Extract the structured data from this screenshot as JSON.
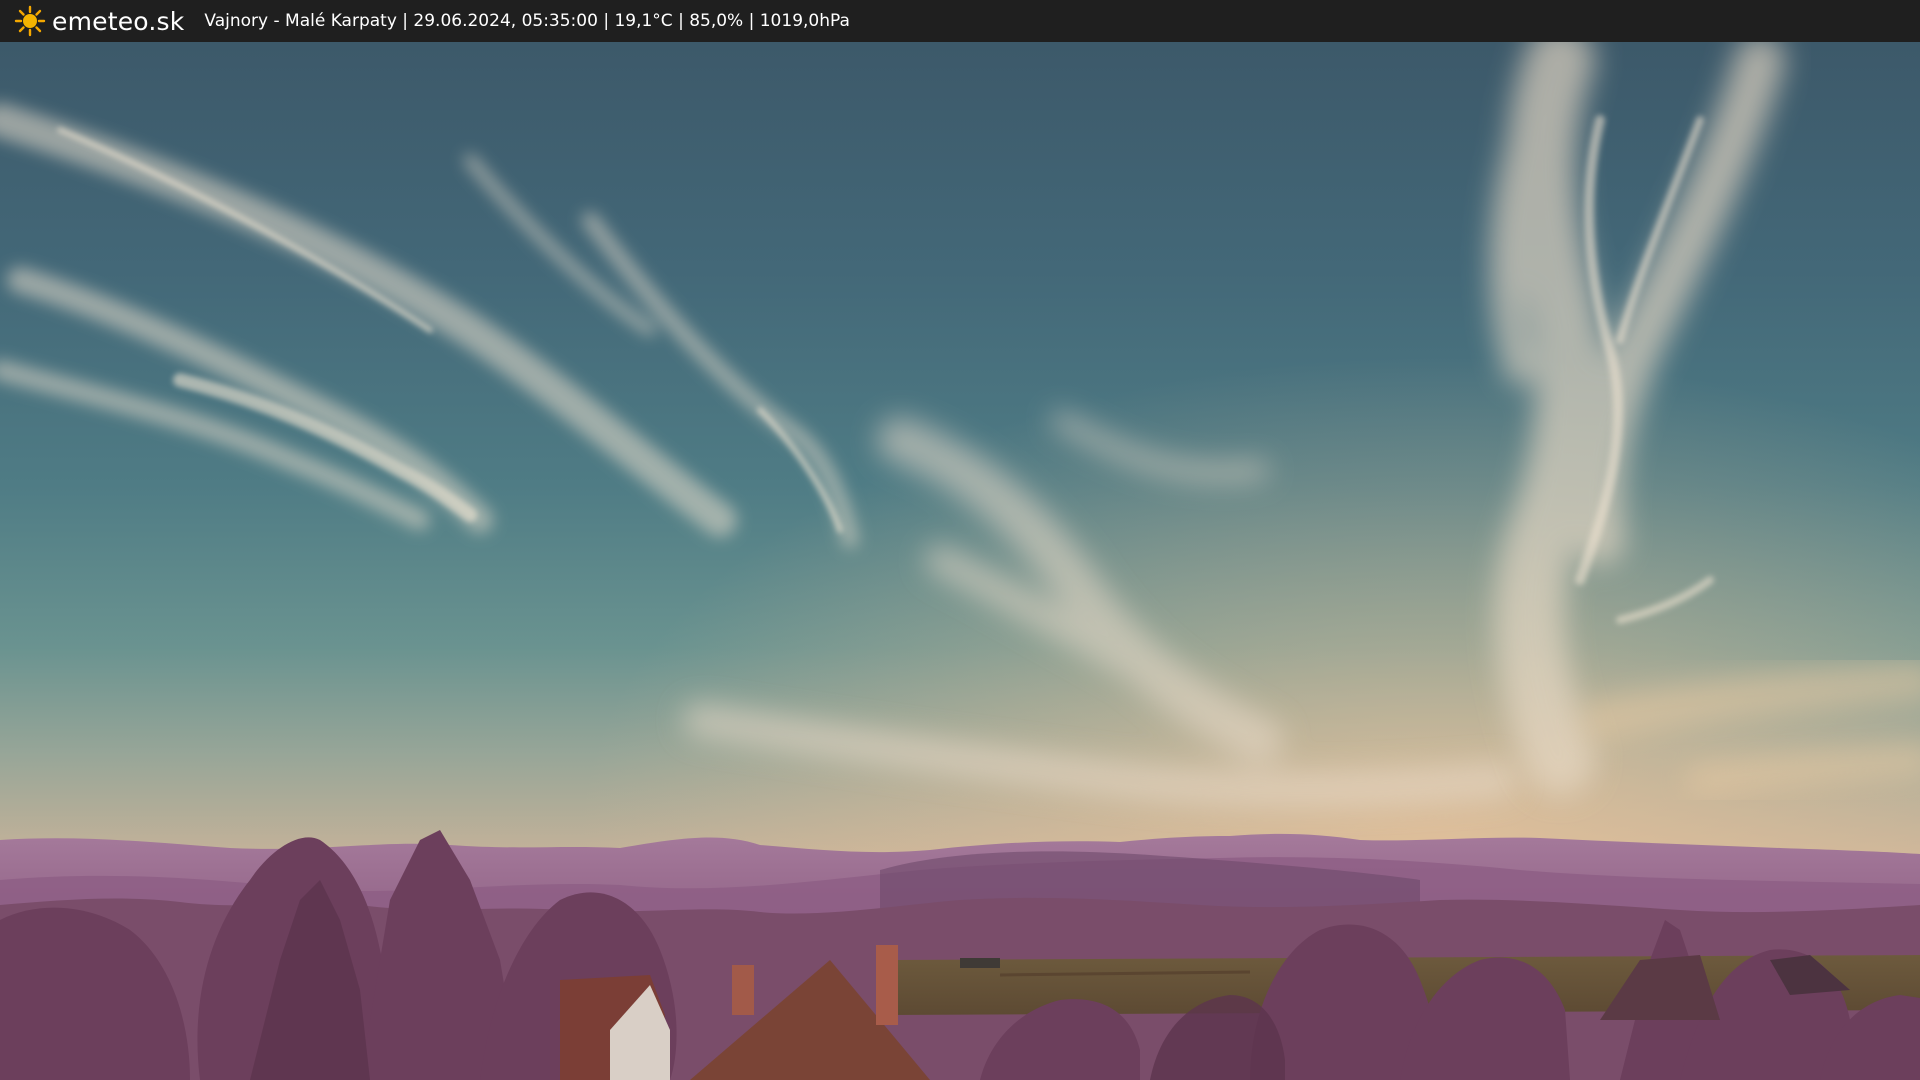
{
  "overlay": {
    "brand": "emeteo.sk",
    "brand_icon": "sun-icon",
    "info": "Vajnory - Malé Karpaty | 29.06.2024, 05:35:00 | 19,1°C | 85,0% | 1019,0hPa"
  },
  "colors": {
    "bar_background": "#1f1f1f",
    "text": "#ffffff",
    "sun": "#f5a800",
    "sky_top": "#3f5e6f",
    "sky_horizon": "#d3b596",
    "hills": "#9b6c92",
    "trees": "#7a4d68"
  }
}
